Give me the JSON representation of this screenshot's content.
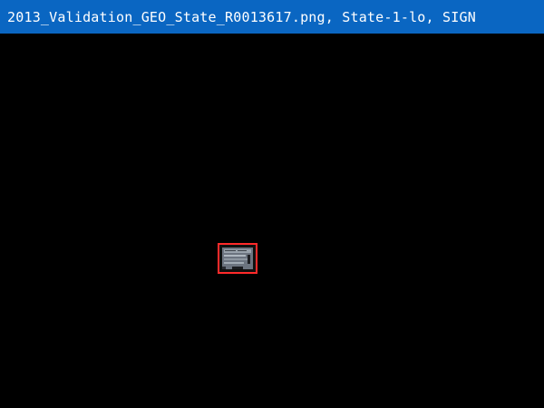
{
  "window": {
    "title": "2013_Validation_GEO_State_R0013617.png, State-1-lo, SIGN",
    "titlebar_color": "#0a66c2",
    "background_color": "#000000"
  },
  "annotation": {
    "box_color": "#ff2a2a",
    "patch_icon": "sign-thumbnail-icon"
  }
}
